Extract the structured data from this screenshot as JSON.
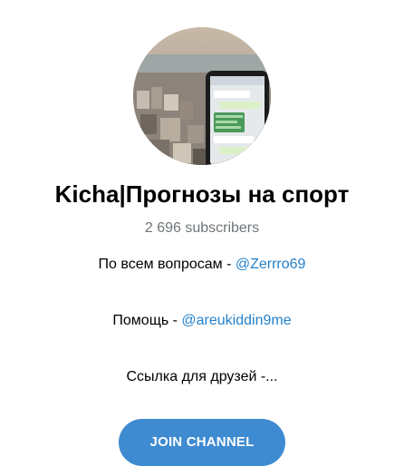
{
  "channel": {
    "title": "Kicha|Прогнозы на спорт",
    "subscribers": "2 696 subscribers"
  },
  "description": {
    "line1_text": "По всем вопросам - ",
    "line1_link": "@Zerrro69",
    "line2_text": "Помощь - ",
    "line2_link": "@areukiddin9me",
    "line3_text": "Ссылка для друзей -..."
  },
  "actions": {
    "join_label": "JOIN CHANNEL"
  },
  "colors": {
    "accent": "#3f8bd1",
    "link": "#2481cc",
    "muted": "#707579"
  }
}
